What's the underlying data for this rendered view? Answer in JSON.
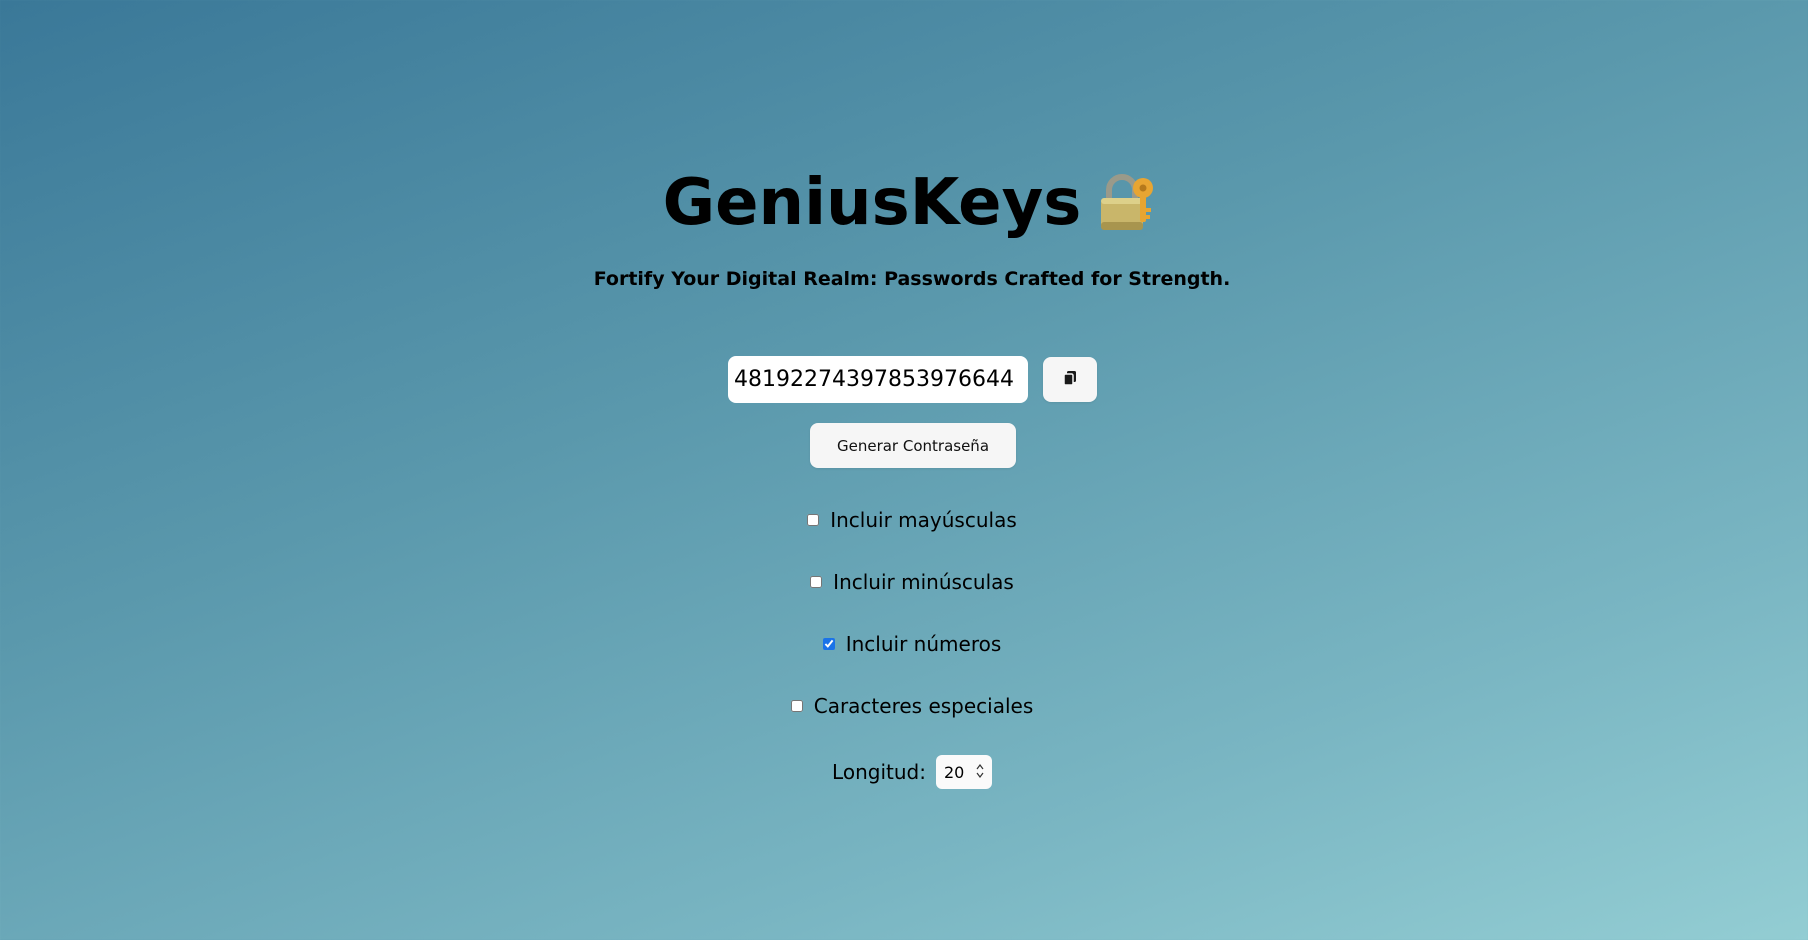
{
  "app": {
    "title": "GeniusKeys",
    "title_icon": "lock-with-key-icon",
    "subtitle": "Fortify Your Digital Realm: Passwords Crafted for Strength."
  },
  "password": {
    "value": "48192274397853976644",
    "copy_icon": "clipboard-copy-icon"
  },
  "generate_button": {
    "label": "Generar Contraseña"
  },
  "options": [
    {
      "label": "Incluir mayúsculas",
      "checked": false
    },
    {
      "label": "Incluir minúsculas",
      "checked": false
    },
    {
      "label": "Incluir números",
      "checked": true
    },
    {
      "label": "Caracteres especiales",
      "checked": false
    }
  ],
  "length": {
    "label": "Longitud:",
    "value": "20"
  },
  "colors": {
    "gradient_start": "#3a7898",
    "gradient_end": "#93cdd3",
    "checkbox_accent": "#1a73e8"
  }
}
